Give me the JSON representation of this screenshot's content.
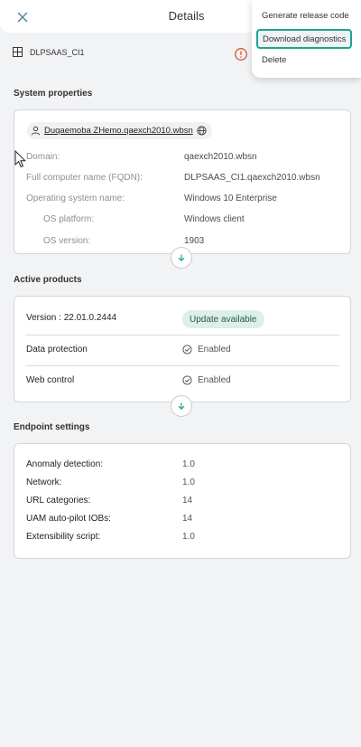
{
  "header": {
    "title": "Details"
  },
  "device": {
    "name": "DLPSAAS_CI1"
  },
  "menu": {
    "items": [
      "Generate release code",
      "Download diagnostics",
      "Delete"
    ]
  },
  "system_properties": {
    "title": "System properties",
    "user": "Duqaemoba ZHemo.qaexch2010.wbsn",
    "rows": [
      {
        "label": "Domain:",
        "value": "qaexch2010.wbsn"
      },
      {
        "label": "Full computer name (FQDN):",
        "value": "DLPSAAS_CI1.qaexch2010.wbsn"
      },
      {
        "label": "Operating system name:",
        "value": "Windows 10 Enterprise"
      },
      {
        "label": "OS platform:",
        "value": "Windows client"
      },
      {
        "label": "OS version:",
        "value": "1903"
      }
    ]
  },
  "active_products": {
    "title": "Active products",
    "version_label": "Version : 22.01.0.2444",
    "badge": "Update available",
    "rows": [
      {
        "label": "Data protection",
        "value": "Enabled"
      },
      {
        "label": "Web control",
        "value": "Enabled"
      }
    ]
  },
  "endpoint_settings": {
    "title": "Endpoint settings",
    "rows": [
      {
        "label": "Anomaly detection:",
        "value": "1.0"
      },
      {
        "label": "Network:",
        "value": "1.0"
      },
      {
        "label": "URL categories:",
        "value": "14"
      },
      {
        "label": "UAM auto-pilot IOBs:",
        "value": "14"
      },
      {
        "label": "Extensibility script:",
        "value": "1.0"
      }
    ]
  },
  "colors": {
    "accent": "#1fa38e",
    "warning": "#e0542b",
    "badge_bg": "#dcefe9"
  },
  "icons": [
    "close-icon",
    "device-grid-icon",
    "warning-icon",
    "user-icon",
    "globe-icon",
    "chevron-down-icon",
    "check-circle-icon"
  ]
}
